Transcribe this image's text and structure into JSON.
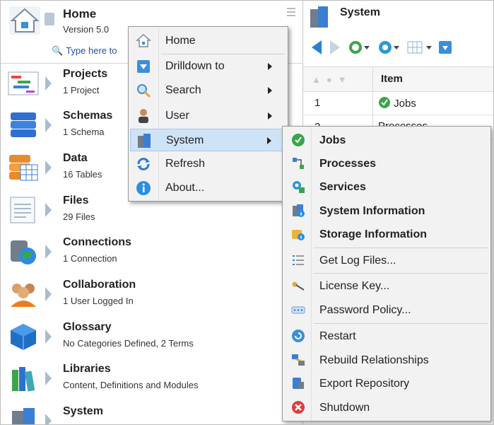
{
  "home": {
    "title": "Home",
    "version": "Version  5.0",
    "search_placeholder": "Type here to"
  },
  "nav_items": [
    {
      "title": "Projects",
      "subtitle": "1 Project",
      "icon": "projects-icon"
    },
    {
      "title": "Schemas",
      "subtitle": "1 Schema",
      "icon": "schemas-icon"
    },
    {
      "title": "Data",
      "subtitle": "16 Tables",
      "icon": "data-icon"
    },
    {
      "title": "Files",
      "subtitle": "29 Files",
      "icon": "files-icon"
    },
    {
      "title": "Connections",
      "subtitle": "1 Connection",
      "icon": "connections-icon"
    },
    {
      "title": "Collaboration",
      "subtitle": "1 User Logged In",
      "icon": "collaboration-icon"
    },
    {
      "title": "Glossary",
      "subtitle": "No Categories Defined, 2 Terms",
      "icon": "glossary-icon"
    },
    {
      "title": "Libraries",
      "subtitle": "Content, Definitions and Modules",
      "icon": "libraries-icon"
    },
    {
      "title": "System",
      "subtitle": "",
      "icon": "system-icon"
    }
  ],
  "system_panel": {
    "title": "System",
    "grid_header": "Item",
    "rows": [
      {
        "num": "1",
        "item": "Jobs"
      },
      {
        "num": "2",
        "item": "Processes"
      }
    ]
  },
  "home_menu": {
    "items": [
      {
        "label": "Home",
        "icon": "home-icon",
        "submenu": false
      },
      {
        "label": "Drilldown to",
        "icon": "drilldown-icon",
        "submenu": true
      },
      {
        "label": "Search",
        "icon": "search-icon",
        "submenu": true
      },
      {
        "label": "User",
        "icon": "user-icon",
        "submenu": true
      },
      {
        "label": "System",
        "icon": "server-icon",
        "submenu": true,
        "active": true
      },
      {
        "label": "Refresh",
        "icon": "refresh-icon",
        "submenu": false
      },
      {
        "label": "About...",
        "icon": "info-icon",
        "submenu": false
      }
    ]
  },
  "system_menu": {
    "items": [
      {
        "label": "Jobs",
        "icon": "jobs-icon",
        "bold": true
      },
      {
        "label": "Processes",
        "icon": "processes-icon",
        "bold": true
      },
      {
        "label": "Services",
        "icon": "services-icon",
        "bold": true
      },
      {
        "label": "System Information",
        "icon": "system-info-icon",
        "bold": true
      },
      {
        "label": "Storage Information",
        "icon": "storage-info-icon",
        "bold": true
      },
      {
        "label": "Get Log Files...",
        "icon": "log-files-icon",
        "bold": false
      },
      {
        "label": "License Key...",
        "icon": "license-key-icon",
        "bold": false
      },
      {
        "label": "Password Policy...",
        "icon": "password-policy-icon",
        "bold": false
      },
      {
        "label": "Restart",
        "icon": "restart-icon",
        "bold": false
      },
      {
        "label": "Rebuild Relationships",
        "icon": "rebuild-icon",
        "bold": false
      },
      {
        "label": "Export Repository",
        "icon": "export-icon",
        "bold": false
      },
      {
        "label": "Shutdown",
        "icon": "shutdown-icon",
        "bold": false
      }
    ]
  },
  "colors": {
    "accent": "#2a7fd4",
    "menu_highlight": "#cfe3f7",
    "link": "#2350a8"
  }
}
